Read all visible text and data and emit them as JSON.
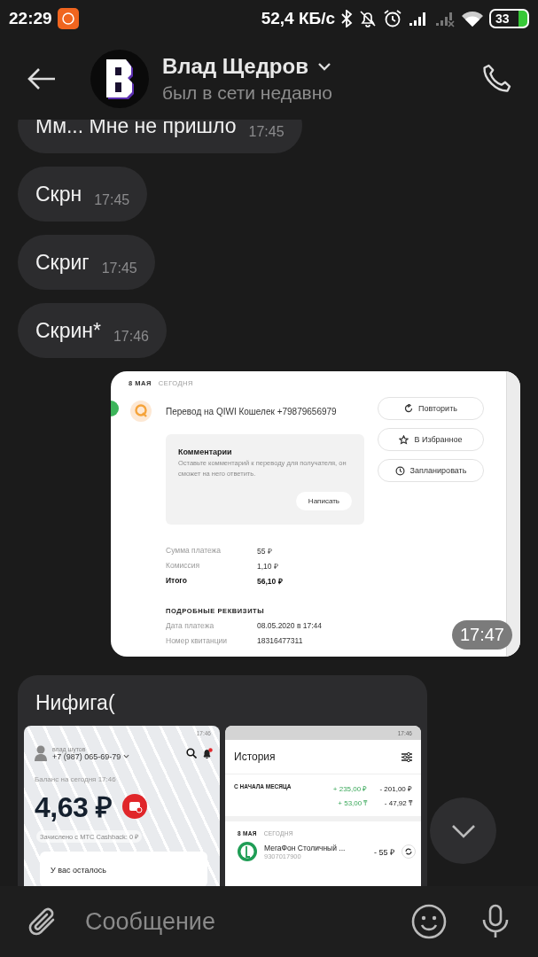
{
  "status_bar": {
    "time": "22:29",
    "speed": "52,4 КБ/с",
    "battery": "33"
  },
  "header": {
    "name": "Влад Щедров",
    "status": "был в сети недавно"
  },
  "messages": [
    {
      "kind": "text",
      "text": "Мм... Мне не пришло",
      "time": "17:45"
    },
    {
      "kind": "text",
      "text": "Скрн",
      "time": "17:45"
    },
    {
      "kind": "text",
      "text": "Скриг",
      "time": "17:45"
    },
    {
      "kind": "text",
      "text": "Скрин*",
      "time": "17:46"
    },
    {
      "kind": "image",
      "time": "17:47",
      "screenshot": {
        "date": "8 МАЯ",
        "day": "СЕГОДНЯ",
        "title": "Перевод на QIWI Кошелек +79879656979",
        "actions": [
          {
            "kind": "repeat",
            "label": "Повторить"
          },
          {
            "kind": "favorite",
            "label": "В Избранное"
          },
          {
            "kind": "schedule",
            "label": "Запланировать"
          }
        ],
        "comment": {
          "title": "Комментарии",
          "hint": "Оставьте комментарий к переводу для получателя, он сможет на него ответить.",
          "button": "Написать"
        },
        "sums": [
          {
            "label": "Сумма платежа",
            "value": "55 ₽",
            "total": false
          },
          {
            "label": "Комиссия",
            "value": "1,10 ₽",
            "total": false
          },
          {
            "label": "Итого",
            "value": "56,10 ₽",
            "total": true
          }
        ],
        "details_title": "ПОДРОБНЫЕ РЕКВИЗИТЫ",
        "details": [
          {
            "label": "Дата платежа",
            "value": "08.05.2020 в 17:44"
          },
          {
            "label": "Номер квитанции",
            "value": "18316477311"
          }
        ]
      }
    },
    {
      "kind": "album",
      "text": "Нифига(",
      "screenshots": [
        {
          "kind": "balance",
          "clock": "17:46",
          "user": "влад шутов",
          "phone": "+7 (987) 065-69-79",
          "balance_label": "Баланс на сегодня 17:46",
          "balance": "4,63 ₽",
          "cashback": "Зачислено с МТС Cashback: 0 ₽",
          "card_title": "У вас осталось"
        },
        {
          "kind": "history",
          "clock": "17:46",
          "title": "История",
          "period": "С НАЧАЛА МЕСЯЦА",
          "totals": [
            {
              "value": "+ 235,00 ₽",
              "income": true
            },
            {
              "value": "- 201,00 ₽",
              "income": false
            },
            {
              "value": "+ 53,00 ₸",
              "income": true
            },
            {
              "value": "- 47,92 ₸",
              "income": false
            }
          ],
          "date": "8 МАЯ",
          "day": "СЕГОДНЯ",
          "operations": [
            {
              "name": "МегаФон Столичный ...",
              "account": "9307017900",
              "amount": "- 55 ₽"
            }
          ]
        }
      ]
    }
  ],
  "composer": {
    "placeholder": "Сообщение"
  }
}
